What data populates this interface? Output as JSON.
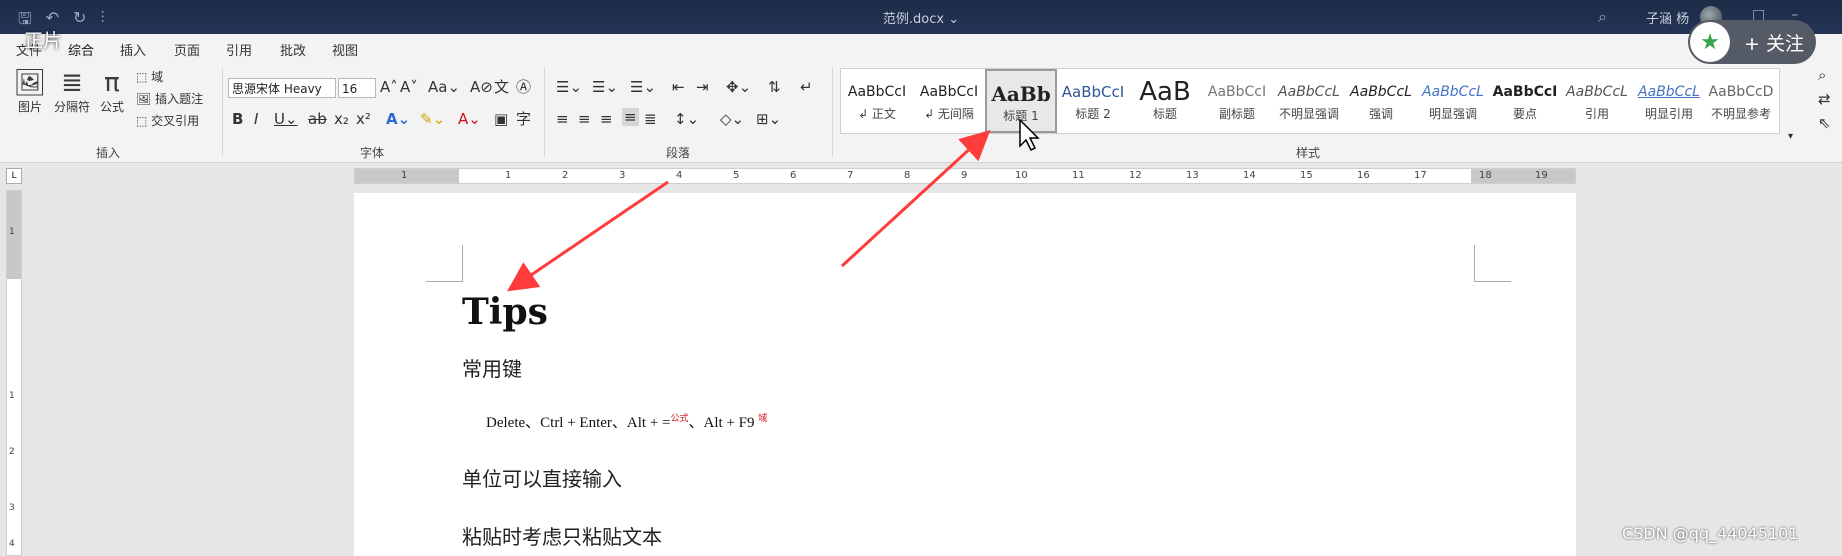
{
  "titlebar": {
    "doc_title": "范例.docx ⌄",
    "user_name": "子涵 杨"
  },
  "overlay": {
    "top_left_text": "正片",
    "follow_label": "+ 关注"
  },
  "tabs": [
    {
      "label": "文件"
    },
    {
      "label": "综合",
      "active": true
    },
    {
      "label": "插入"
    },
    {
      "label": "页面"
    },
    {
      "label": "引用"
    },
    {
      "label": "批改"
    },
    {
      "label": "视图"
    }
  ],
  "ribbon": {
    "insert_group": {
      "label": "插入",
      "picture": "图片",
      "separator": "分隔符",
      "formula": "公式",
      "field": "域",
      "insert_caption": "插入题注",
      "cross_ref": "交叉引用"
    },
    "font_group": {
      "label": "字体",
      "font_name": "思源宋体 Heavy",
      "font_size": "16"
    },
    "paragraph_group": {
      "label": "段落"
    },
    "styles_group": {
      "label": "样式",
      "items": [
        {
          "preview": "AaBbCcI",
          "name": "↲ 正文"
        },
        {
          "preview": "AaBbCcI",
          "name": "↲ 无间隔"
        },
        {
          "preview": "AaBb",
          "name": "标题 1",
          "selected": true
        },
        {
          "preview": "AaBbCcI",
          "name": "标题 2"
        },
        {
          "preview": "AaB",
          "name": "标题"
        },
        {
          "preview": "AaBbCcI",
          "name": "副标题"
        },
        {
          "preview": "AaBbCcL",
          "name": "不明显强调"
        },
        {
          "preview": "AaBbCcL",
          "name": "强调"
        },
        {
          "preview": "AaBbCcL",
          "name": "明显强调"
        },
        {
          "preview": "AaBbCcI",
          "name": "要点"
        },
        {
          "preview": "AaBbCcL",
          "name": "引用"
        },
        {
          "preview": "AaBbCcL",
          "name": "明显引用"
        },
        {
          "preview": "AaBbCcD",
          "name": "不明显参考"
        }
      ]
    }
  },
  "ruler": {
    "h_numbers": [
      "1",
      "1",
      "2",
      "3",
      "4",
      "5",
      "6",
      "7",
      "8",
      "9",
      "10",
      "11",
      "12",
      "13",
      "14",
      "15",
      "16",
      "17",
      "18",
      "19"
    ],
    "v_numbers": [
      "1",
      "1",
      "2",
      "3",
      "4"
    ]
  },
  "document": {
    "heading": "Tips",
    "para1": "常用键",
    "shortcuts_a": "Delete、Ctrl + Enter、Alt + =",
    "shortcuts_sup1": "公式",
    "shortcuts_b": "、Alt + F9 ",
    "shortcuts_sup2": "域",
    "para2": "单位可以直接输入",
    "para3": "粘贴时考虑只粘贴文本"
  },
  "watermark": "CSDN @qq_44045101",
  "colors": {
    "titlebar": "#1d2b47",
    "accent": "#2b579a",
    "arrow": "#ff3b3b",
    "annotation_red": "#d0101b"
  }
}
